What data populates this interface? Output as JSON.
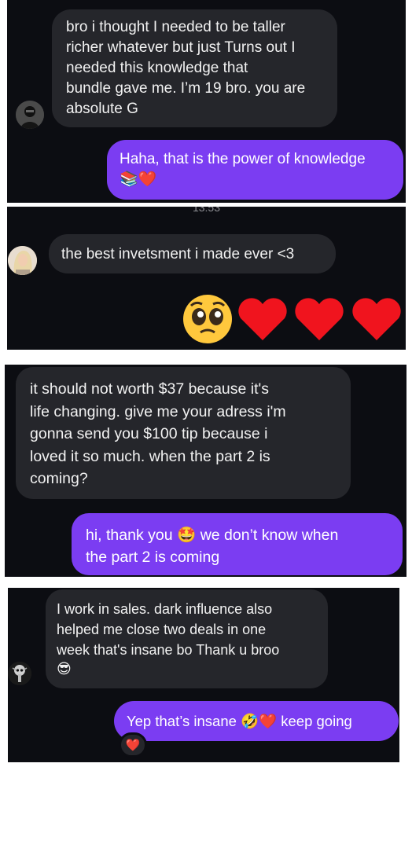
{
  "panel1": {
    "received_text": "bro i  thought I needed to be taller\nricher whatever but just Turns out I\nneeded this knowledge that\nbundle gave me. I’m 19 bro. you are\nabsolute G",
    "sent_text": "Haha, that is the power of knowledge",
    "sent_emojis": "📚❤️",
    "avatar_icon": "dark-hooded-avatar"
  },
  "panel2": {
    "timestamp": "13:53",
    "received_text": "the best invetsment i made ever <3",
    "reaction_emojis": "🥺❤️❤️❤️",
    "avatar_icon": "blonde-avatar"
  },
  "panel3": {
    "received_text": "it should not worth $37 because it's\nlife changing. give me your adress i'm\ngonna send you $100 tip because i\nloved it so much. when the part 2 is\ncoming?",
    "sent_text_before": "hi, thank you",
    "sent_emoji": "🤩",
    "sent_text_after": "we don’t know when\nthe part 2 is coming"
  },
  "panel4": {
    "received_text": "I work in sales. dark influence also\nhelped me close two deals in one\nweek that's insane bo Thank u broo",
    "received_emoji": "😎",
    "sent_text_before": "Yep that’s insane",
    "sent_emojis": "🤣❤️",
    "sent_text_after": "keep going",
    "reaction": "❤️",
    "avatar_icon": "skull-tree-avatar"
  },
  "colors": {
    "panel_bg": "#0c0d12",
    "received_bubble": "#25262b",
    "sent_bubble": "#7b3df2"
  }
}
